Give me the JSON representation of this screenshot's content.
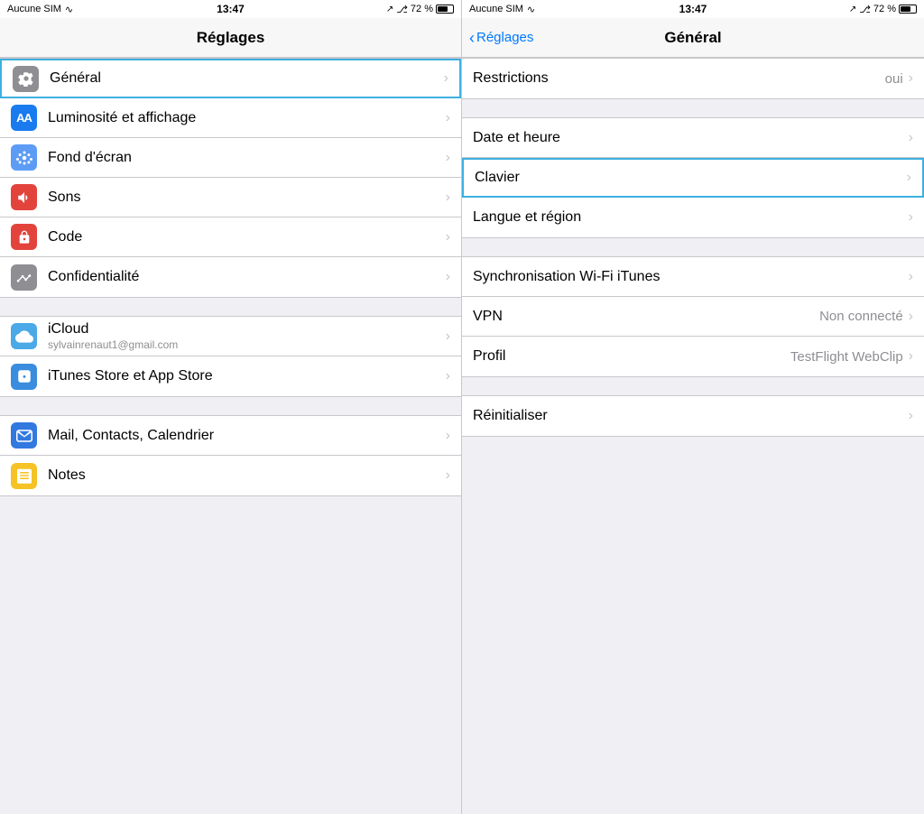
{
  "left": {
    "statusBar": {
      "left": "Aucune SIM",
      "wifi": "wifi",
      "time": "13:47",
      "arrow": "↗",
      "bluetooth": "bluetooth",
      "battery": "72 %"
    },
    "navTitle": "Réglages",
    "groups": [
      {
        "id": "group1",
        "rows": [
          {
            "id": "general",
            "icon": "gear",
            "iconClass": "gray",
            "label": "Général",
            "selected": true,
            "chevron": true
          },
          {
            "id": "brightness",
            "icon": "AA",
            "iconClass": "blue-bright",
            "label": "Luminosité et affichage",
            "selected": false,
            "chevron": true
          },
          {
            "id": "wallpaper",
            "icon": "flower",
            "iconClass": "blue-flower",
            "label": "Fond d'écran",
            "selected": false,
            "chevron": true
          },
          {
            "id": "sounds",
            "icon": "speaker",
            "iconClass": "red",
            "label": "Sons",
            "selected": false,
            "chevron": true
          },
          {
            "id": "passcode",
            "icon": "lock",
            "iconClass": "red-lock",
            "label": "Code",
            "selected": false,
            "chevron": true
          },
          {
            "id": "privacy",
            "icon": "hand",
            "iconClass": "gray-hand",
            "label": "Confidentialité",
            "selected": false,
            "chevron": true
          }
        ]
      },
      {
        "id": "group2",
        "rows": [
          {
            "id": "icloud",
            "icon": "cloud",
            "iconClass": "blue-cloud",
            "label": "iCloud",
            "sublabel": "sylvainrenaut1@gmail.com",
            "selected": false,
            "chevron": true
          },
          {
            "id": "itunes",
            "icon": "app",
            "iconClass": "blue-app",
            "label": "iTunes Store et App Store",
            "selected": false,
            "chevron": true
          }
        ]
      },
      {
        "id": "group3",
        "rows": [
          {
            "id": "mail",
            "icon": "mail",
            "iconClass": "blue-mail",
            "label": "Mail, Contacts, Calendrier",
            "selected": false,
            "chevron": true
          },
          {
            "id": "notes",
            "icon": "notes",
            "iconClass": "yellow-notes",
            "label": "Notes",
            "selected": false,
            "chevron": true
          }
        ]
      }
    ]
  },
  "right": {
    "statusBar": {
      "left": "Aucune SIM",
      "wifi": "wifi",
      "time": "13:47",
      "arrow": "↗",
      "bluetooth": "bluetooth",
      "battery": "72 %"
    },
    "navBack": "Réglages",
    "navTitle": "Général",
    "groups": [
      {
        "id": "rgroup1",
        "rows": [
          {
            "id": "restrictions",
            "label": "Restrictions",
            "value": "oui",
            "selected": false,
            "chevron": true
          }
        ]
      },
      {
        "id": "rgroup2",
        "rows": [
          {
            "id": "datetime",
            "label": "Date et heure",
            "value": "",
            "selected": false,
            "chevron": true
          },
          {
            "id": "clavier",
            "label": "Clavier",
            "value": "",
            "selected": true,
            "chevron": true
          },
          {
            "id": "langue",
            "label": "Langue et région",
            "value": "",
            "selected": false,
            "chevron": true
          }
        ]
      },
      {
        "id": "rgroup3",
        "rows": [
          {
            "id": "sync",
            "label": "Synchronisation Wi-Fi iTunes",
            "value": "",
            "selected": false,
            "chevron": true
          },
          {
            "id": "vpn",
            "label": "VPN",
            "value": "Non connecté",
            "selected": false,
            "chevron": true
          },
          {
            "id": "profil",
            "label": "Profil",
            "value": "TestFlight WebClip",
            "selected": false,
            "chevron": true
          }
        ]
      },
      {
        "id": "rgroup4",
        "rows": [
          {
            "id": "reinitialiser",
            "label": "Réinitialiser",
            "value": "",
            "selected": false,
            "chevron": true
          }
        ]
      }
    ]
  }
}
